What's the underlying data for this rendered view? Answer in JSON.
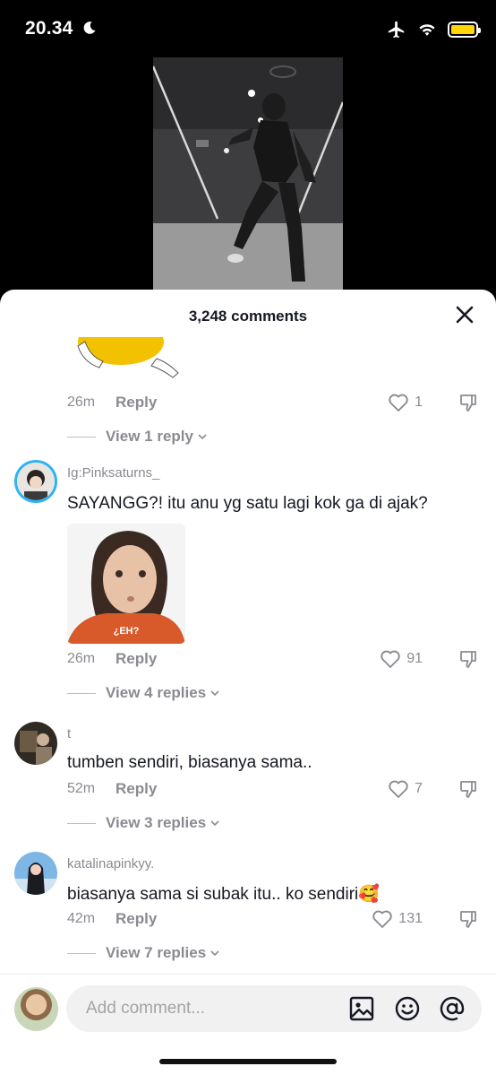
{
  "status_bar": {
    "time": "20.34",
    "battery_color": "#FFD60A"
  },
  "sheet": {
    "title": "3,248 comments"
  },
  "comments": [
    {
      "username": "",
      "text": "",
      "age": "26m",
      "reply_label": "Reply",
      "likes": "1",
      "view_replies": "View 1 reply"
    },
    {
      "username": "Ig:Pinksaturns_",
      "text": "SAYANGG?! itu anu yg satu lagi kok ga di ajak?",
      "sticker_caption": "¿EH?",
      "age": "26m",
      "reply_label": "Reply",
      "likes": "91",
      "view_replies": "View 4 replies"
    },
    {
      "username": "t",
      "text": "tumben sendiri, biasanya sama..",
      "age": "52m",
      "reply_label": "Reply",
      "likes": "7",
      "view_replies": "View 3 replies"
    },
    {
      "username": "katalinapinkyy.",
      "text": "biasanya sama si subak itu.. ko sendiri🥰",
      "age": "42m",
      "reply_label": "Reply",
      "likes": "131",
      "view_replies": "View 7 replies"
    }
  ],
  "composer": {
    "placeholder": "Add comment..."
  }
}
